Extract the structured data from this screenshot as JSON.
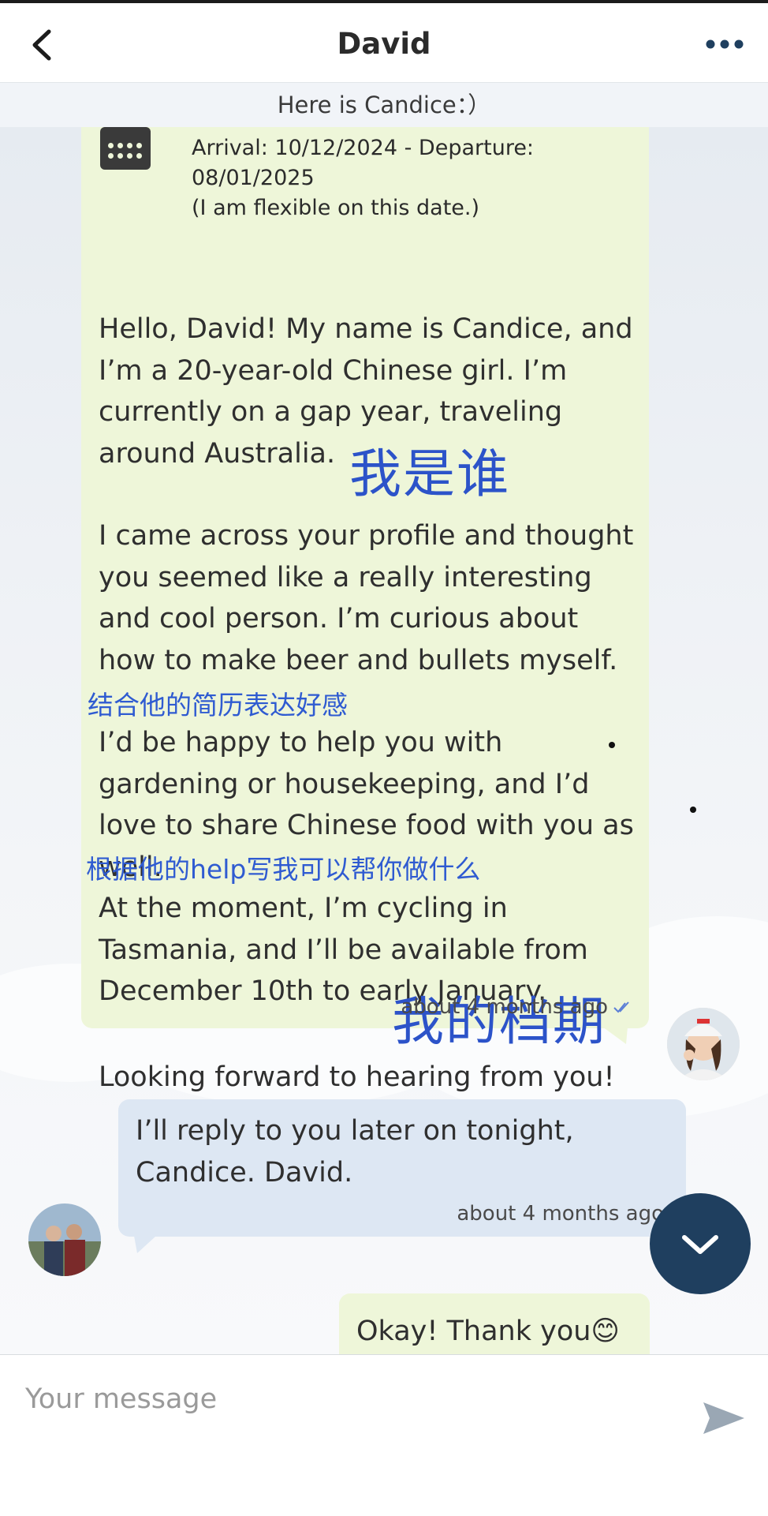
{
  "header": {
    "title": "David",
    "back_icon": "chevron-left-icon",
    "more_icon": "more-horizontal-icon"
  },
  "banner": {
    "text": "Here is Candice：）"
  },
  "message_in": {
    "arrival": "Arrival: 10/12/2024 - Departure: 08/01/2025",
    "flexible": "(I am flexible on this date.)",
    "p1": "Hello, David! My name is Candice, and I’m a 20-year-old Chinese girl. I’m currently on a gap year, traveling around Australia.",
    "p2": "I came across your profile and thought you seemed like a really interesting and cool person. I’m curious about how to make beer and bullets myself.",
    "p3": "I’d be happy to help you with gardening or housekeeping, and I’d love to share Chinese food with you as well.",
    "p4": "At the moment, I’m cycling in Tasmania, and I’ll be available from December 10th to early January.",
    "p5": "Looking forward to hearing from you!",
    "time": "about 4 months ago",
    "note1": "我是谁",
    "note2": "结合他的简历表达好感",
    "note3": "根据他的help写我可以帮你做什么",
    "note4": "我的档期"
  },
  "message_out": {
    "text": "I’ll reply to you later on tonight, Candice. David.",
    "time": "about 4 months ago"
  },
  "message_last": {
    "text": "Okay!  Thank you😊"
  },
  "composer": {
    "placeholder": "Your message"
  },
  "colors": {
    "accent": "#1f3f5f",
    "incoming_bubble": "#eef6d9",
    "outgoing_bubble": "#dde7f3",
    "annotation": "#2c53c9"
  }
}
